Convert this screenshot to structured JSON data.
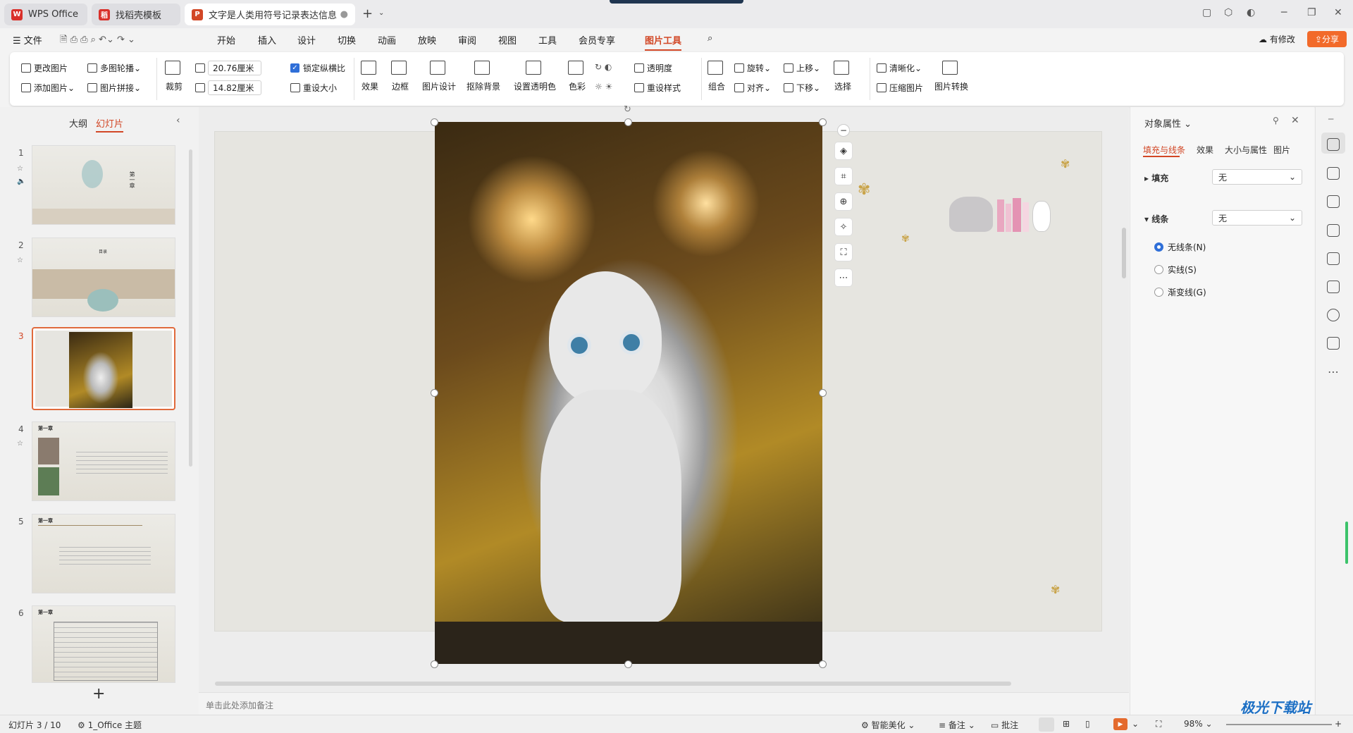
{
  "tabs": [
    {
      "label": "WPS Office",
      "logo": "W",
      "color": "#d9302a"
    },
    {
      "label": "找稻壳模板",
      "logo": "稻",
      "color": "#d9302a"
    },
    {
      "label": "文字是人类用符号记录表达信息以",
      "logo": "P",
      "color": "#d24726"
    }
  ],
  "menu": {
    "file": "文件",
    "items": [
      "开始",
      "插入",
      "设计",
      "切换",
      "动画",
      "放映",
      "审阅",
      "视图",
      "工具",
      "会员专享",
      "图片工具"
    ],
    "modify": "有修改",
    "share": "分享"
  },
  "ribbon": {
    "change_pic": "更改图片",
    "add_pic": "添加图片",
    "multi_outline": "多图轮播",
    "pic_splice": "图片拼接",
    "crop": "裁剪",
    "width": "20.76厘米",
    "height": "14.82厘米",
    "lock_ratio": "锁定纵横比",
    "reset_size": "重设大小",
    "effect": "效果",
    "border": "边框",
    "pic_design": "图片设计",
    "remove_bg": "抠除背景",
    "set_transparent": "设置透明色",
    "color": "色彩",
    "transparency": "透明度",
    "reset_style": "重设样式",
    "combine": "组合",
    "rotate": "旋转",
    "align": "对齐",
    "move_up": "上移",
    "move_down": "下移",
    "select": "选择",
    "clarify": "清晰化",
    "compress": "压缩图片",
    "pic_convert": "图片转换"
  },
  "left_panel": {
    "outline": "大纲",
    "slides": "幻灯片",
    "slide_numbers": [
      "1",
      "2",
      "3",
      "4",
      "5",
      "6"
    ],
    "slide1_title": "第一章",
    "slide2_title": "目录",
    "slide4_title": "第一章",
    "slide5_title": "第一章",
    "slide6_title": "第一章"
  },
  "notes_placeholder": "单击此处添加备注",
  "props": {
    "title": "对象属性",
    "tabs": [
      "填充与线条",
      "效果",
      "大小与属性",
      "图片"
    ],
    "fill_label": "填充",
    "fill_value": "无",
    "line_label": "线条",
    "line_value": "无",
    "options": [
      "无线条(N)",
      "实线(S)",
      "渐变线(G)"
    ]
  },
  "status": {
    "slide_info": "幻灯片 3 / 10",
    "theme": "1_Office 主题",
    "beautify": "智能美化",
    "notes": "备注",
    "comment": "批注",
    "zoom": "98%"
  },
  "watermark": "极光下载站"
}
